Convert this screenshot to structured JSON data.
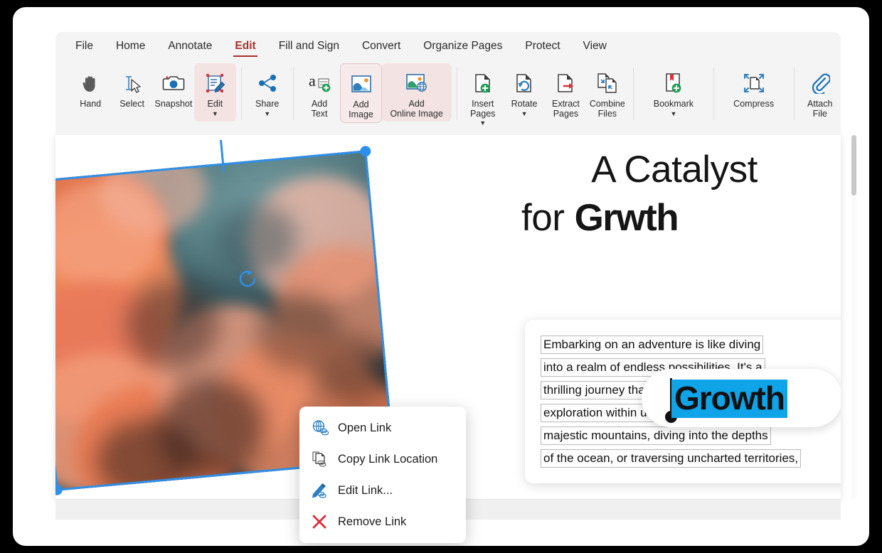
{
  "menubar": {
    "items": [
      {
        "label": "File",
        "active": false
      },
      {
        "label": "Home",
        "active": false
      },
      {
        "label": "Annotate",
        "active": false
      },
      {
        "label": "Edit",
        "active": true
      },
      {
        "label": "Fill and Sign",
        "active": false
      },
      {
        "label": "Convert",
        "active": false
      },
      {
        "label": "Organize Pages",
        "active": false
      },
      {
        "label": "Protect",
        "active": false
      },
      {
        "label": "View",
        "active": false
      }
    ],
    "active_tab_color": "#a8322a"
  },
  "toolbar": {
    "tools": [
      {
        "name": "hand",
        "label": "Hand",
        "icon": "hand-icon",
        "caret": false,
        "state": "normal"
      },
      {
        "name": "select",
        "label": "Select",
        "icon": "select-cursor-icon",
        "caret": false,
        "state": "normal"
      },
      {
        "name": "snapshot",
        "label": "Snapshot",
        "icon": "camera-icon",
        "caret": false,
        "state": "normal"
      },
      {
        "name": "edit",
        "label": "Edit",
        "icon": "edit-document-icon",
        "caret": true,
        "state": "selected"
      },
      {
        "name": "share",
        "label": "Share",
        "icon": "share-nodes-icon",
        "caret": true,
        "state": "normal"
      },
      {
        "name": "add-text",
        "label": "Add\nText",
        "icon": "add-text-icon",
        "caret": false,
        "state": "normal"
      },
      {
        "name": "add-image",
        "label": "Add\nImage",
        "icon": "picture-icon",
        "caret": false,
        "state": "active-outlined"
      },
      {
        "name": "add-online-image",
        "label": "Add\nOnline Image",
        "icon": "online-picture-icon",
        "caret": false,
        "state": "active"
      },
      {
        "name": "insert-pages",
        "label": "Insert\nPages",
        "icon": "page-plus-icon",
        "caret": true,
        "state": "normal"
      },
      {
        "name": "rotate",
        "label": "Rotate",
        "icon": "page-rotate-icon",
        "caret": true,
        "state": "normal"
      },
      {
        "name": "extract-pages",
        "label": "Extract\nPages",
        "icon": "page-extract-icon",
        "caret": false,
        "state": "normal"
      },
      {
        "name": "combine-files",
        "label": "Combine\nFiles",
        "icon": "combine-pages-icon",
        "caret": false,
        "state": "normal"
      },
      {
        "name": "bookmark",
        "label": "Bookmark",
        "icon": "bookmark-plus-icon",
        "caret": true,
        "state": "normal"
      },
      {
        "name": "compress",
        "label": "Compress",
        "icon": "compress-arrows-icon",
        "caret": false,
        "state": "normal"
      },
      {
        "name": "attach-file",
        "label": "Attach\nFile",
        "icon": "paperclip-icon",
        "caret": false,
        "state": "normal"
      }
    ],
    "highlight_bg": "#f3e3e3"
  },
  "document": {
    "headline": {
      "line1": "A Catalyst",
      "line2_prefix": "for ",
      "line2_bold": "Grwth"
    },
    "edit_bubble": {
      "selected_text": "Growth",
      "selection_color": "#0fa3e8"
    },
    "paragraph_lines": [
      "Embarking on an adventure is like diving",
      "into a realm of endless possibilities. It's a",
      "thrilling journey that ignites the spirit of",
      "exploration within us. Whether scaling",
      "majestic mountains, diving into the depths",
      "of the ocean, or traversing uncharted territories,"
    ],
    "image_selection": {
      "name": "clouds-photo",
      "handle_color": "#2f8fe8",
      "rotation_handle": "rotate-handle-icon"
    }
  },
  "context_menu": {
    "items": [
      {
        "label": "Open Link",
        "icon": "globe-link-icon"
      },
      {
        "label": "Copy Link Location",
        "icon": "copy-link-icon"
      },
      {
        "label": "Edit Link...",
        "icon": "pencil-link-icon"
      },
      {
        "label": "Remove Link",
        "icon": "remove-x-icon"
      }
    ]
  }
}
